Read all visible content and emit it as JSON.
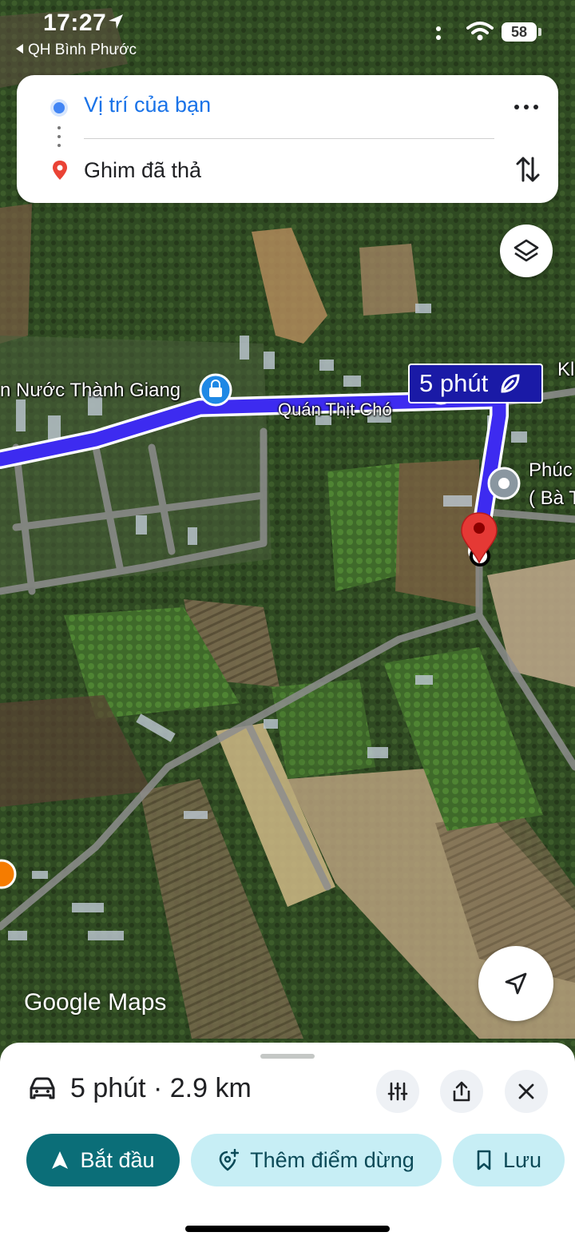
{
  "status_bar": {
    "time": "17:27",
    "back_app": "QH Bình Phước",
    "battery": "58"
  },
  "directions": {
    "from": "Vị trí của bạn",
    "to": "Ghim đã thả"
  },
  "map": {
    "labels": {
      "poi_water": "n Nước Thành Giang",
      "poi_restaurant": "Quán Thịt Chó",
      "poi_right_1": "Phúc",
      "poi_right_2": "( Bà T",
      "edge_label": "Kl"
    },
    "duration_badge": "5 phút",
    "watermark": "Google Maps",
    "route_color": "#3d2bf0"
  },
  "route_summary": {
    "summary": "5 phút · 2.9 km"
  },
  "actions": {
    "start": "Bắt đầu",
    "add_stop": "Thêm điểm dừng",
    "save": "Lưu"
  },
  "icons": [
    "location-arrow-icon",
    "wifi-icon",
    "more-icon",
    "swap-icon",
    "layers-icon",
    "navigation-arrow-icon",
    "car-icon",
    "route-options-icon",
    "share-icon",
    "close-icon",
    "navigation-icon",
    "add-location-icon",
    "bookmark-icon",
    "red-pin-icon",
    "grey-pin-icon",
    "shopping-bag-icon",
    "restaurant-icon",
    "leaf-icon"
  ]
}
